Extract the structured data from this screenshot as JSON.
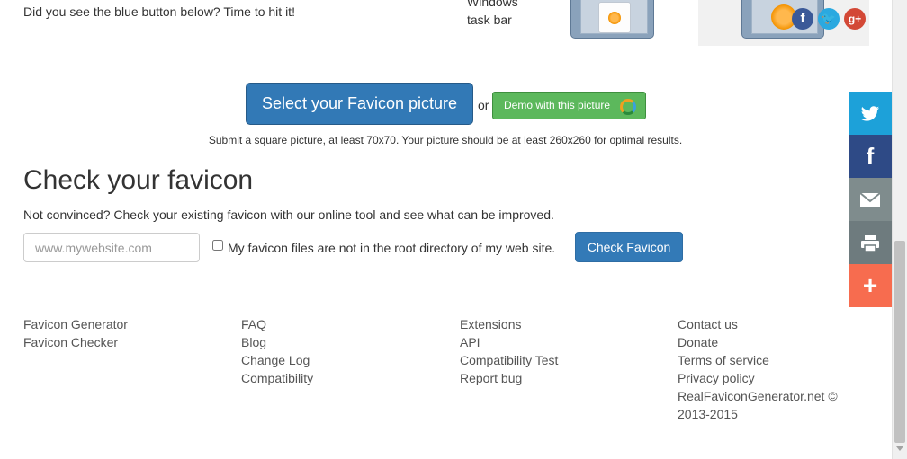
{
  "top": {
    "blurb": "Did you see the blue button below? Time to hit it!",
    "taskbar_label_line1": "Windows",
    "taskbar_label_line2": "task bar"
  },
  "upload": {
    "select_label": "Select your Favicon picture",
    "or_text": "or",
    "demo_label": "Demo with this picture",
    "note": "Submit a square picture, at least 70x70. Your picture should be at least 260x260 for optimal results."
  },
  "check": {
    "title": "Check your favicon",
    "description": "Not convinced? Check your existing favicon with our online tool and see what can be improved.",
    "url_placeholder": "www.mywebsite.com",
    "url_value": "",
    "root_checkbox_label": "My favicon files are not in the root directory of my web site.",
    "root_checkbox_checked": false,
    "button_label": "Check Favicon"
  },
  "footer": {
    "columns": [
      [
        "Favicon Generator",
        "Favicon Checker"
      ],
      [
        "FAQ",
        "Blog",
        "Change Log",
        "Compatibility"
      ],
      [
        "Extensions",
        "API",
        "Compatibility Test",
        "Report bug"
      ],
      [
        "Contact us",
        "Donate",
        "Terms of service",
        "Privacy policy"
      ]
    ],
    "copyright_line1": "RealFaviconGenerator.net ©",
    "copyright_line2": "2013-2015"
  },
  "share": {
    "items": [
      {
        "name": "twitter",
        "icon": "twitter-icon",
        "color": "#1da1d9"
      },
      {
        "name": "facebook",
        "icon": "facebook-icon",
        "color": "#2e4a86"
      },
      {
        "name": "email",
        "icon": "mail-icon",
        "color": "#7f8c8d"
      },
      {
        "name": "print",
        "icon": "print-icon",
        "color": "#6e7b7e"
      },
      {
        "name": "more",
        "icon": "plus-icon",
        "color": "#f76c4f"
      }
    ]
  },
  "colors": {
    "primary": "#337ab7",
    "success": "#5cb85c"
  }
}
